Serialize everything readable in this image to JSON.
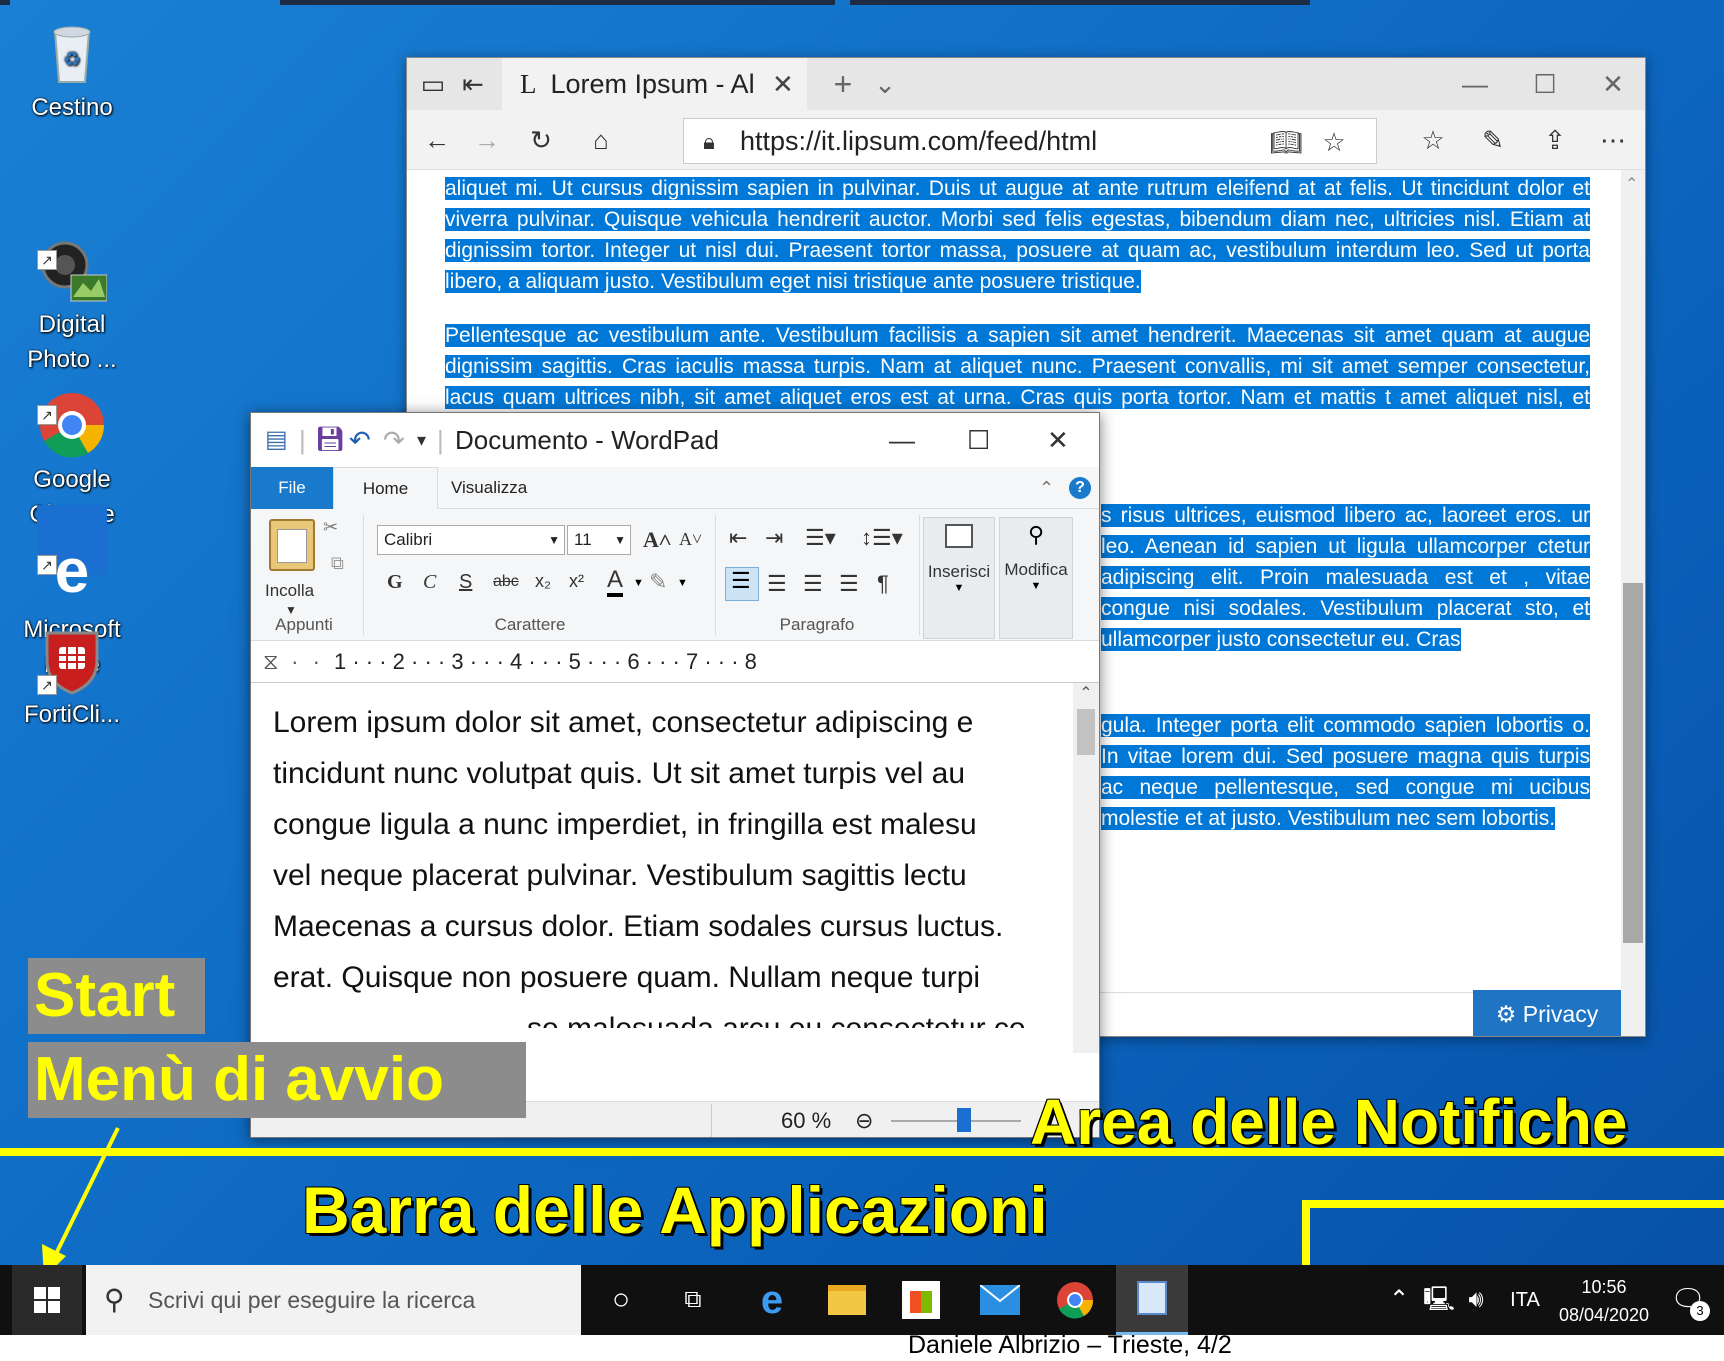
{
  "desktop": {
    "icons": [
      {
        "label": "Cestino"
      },
      {
        "label": "Digital\nPhoto ..."
      },
      {
        "label": "Google\nChrome"
      },
      {
        "label": "Microsoft\nEdge"
      },
      {
        "label": "FortiCli..."
      }
    ]
  },
  "edge": {
    "tab_title": "Lorem Ipsum - Al",
    "url": "https://it.lipsum.com/feed/html",
    "paragraphs": [
      "aliquet mi. Ut cursus dignissim sapien in pulvinar. Duis ut augue at ante rutrum eleifend at at felis. Ut tincidunt dolor et viverra pulvinar. Quisque vehicula hendrerit auctor. Morbi sed felis egestas, bibendum diam nec, ultricies nisl. Etiam at dignissim tortor. Integer ut nisl dui. Praesent tortor massa, posuere at quam ac, vestibulum interdum leo. Sed ut porta libero, a aliquam justo. Vestibulum eget nisi tristique ante posuere tristique.",
      "Pellentesque ac vestibulum ante. Vestibulum facilisis a sapien sit amet hendrerit. Maecenas sit amet quam at augue dignissim sagittis. Cras iaculis massa turpis. Nam at aliquet nunc. Praesent convallis, mi sit amet semper consectetur, lacus quam ultrices nibh, sit amet aliquet eros est at urna. Cras quis porta tortor. Nam et mattis t amet aliquet nisl, et laoreet sem. Vestibulum vulputate vehicula sit amet a lectus.",
      "s risus ultrices, euismod libero ac, laoreet eros. ur leo. Aenean id sapien ut ligula ullamcorper ctetur adipiscing elit. Proin malesuada est et , vitae congue nisi sodales. Vestibulum placerat sto, et ullamcorper justo consectetur eu. Cras",
      "gula. Integer porta elit commodo sapien lobortis o. In vitae lorem dui. Sed posuere magna quis turpis ac neque pellentesque, sed congue mi ucibus molestie et at justo. Vestibulum nec sem lobortis."
    ],
    "privacy_label": "Privacy"
  },
  "wordpad": {
    "title": "Documento - WordPad",
    "tabs": {
      "file": "File",
      "home": "Home",
      "view": "Visualizza"
    },
    "clipboard": {
      "paste": "Incolla",
      "group": "Appunti"
    },
    "font": {
      "name": "Calibri",
      "size": "11",
      "group": "Carattere"
    },
    "paragraph": {
      "group": "Paragrafo"
    },
    "insert_label": "Inserisci",
    "edit_label": "Modifica",
    "ruler": "1 · · · 2 · · · 3 · · · 4 · · · 5 · · · 6 · · · 7 · · · 8",
    "doc_lines": [
      "Lorem ipsum dolor sit amet, consectetur adipiscing e",
      "tincidunt nunc volutpat quis. Ut sit amet turpis vel au",
      "congue ligula a nunc imperdiet, in fringilla est malesu",
      "vel neque placerat pulvinar. Vestibulum sagittis lectu",
      "Maecenas a cursus dolor. Etiam sodales cursus luctus.",
      "erat. Quisque non posuere quam. Nullam neque turpi",
      "se malesuada arcu eu consectetur co"
    ],
    "zoom": "60 %"
  },
  "annotations": {
    "start": "Start",
    "start_menu": "Menù di avvio",
    "taskbar": "Barra delle Applicazioni",
    "notifications": "Area delle Notifiche"
  },
  "taskbar": {
    "search_placeholder": "Scrivi qui per eseguire la ricerca",
    "lang": "ITA",
    "time": "10:56",
    "date": "08/04/2020",
    "notif_count": "3"
  },
  "caption": "Daniele Albrizio – Trieste,  4/2",
  "colors": {
    "selection": "#0078d7",
    "annotation": "#ffff00",
    "taskbar": "#101010"
  }
}
